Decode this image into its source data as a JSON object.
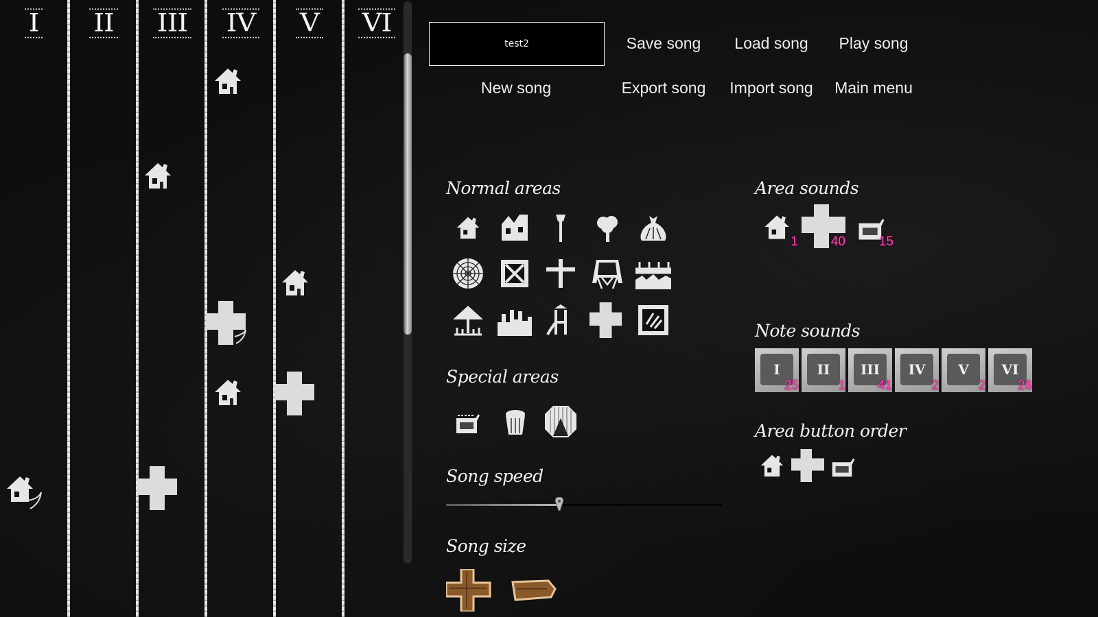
{
  "grid": {
    "columns": [
      {
        "label": "I"
      },
      {
        "label": "II"
      },
      {
        "label": "III"
      },
      {
        "label": "IV"
      },
      {
        "label": "V"
      },
      {
        "label": "VI"
      }
    ],
    "placed_areas": [
      {
        "column": "IV",
        "row": 1,
        "area": "house"
      },
      {
        "column": "III",
        "row": 3,
        "area": "house"
      },
      {
        "column": "V",
        "row": 5,
        "area": "house"
      },
      {
        "column": "IV",
        "row": 6,
        "area": "cross",
        "flag": "note-tail"
      },
      {
        "column": "IV",
        "row": 7,
        "area": "house"
      },
      {
        "column": "V",
        "row": 7,
        "area": "cross"
      },
      {
        "column": "I",
        "row": 9,
        "area": "house",
        "flag": "note-tail"
      },
      {
        "column": "III",
        "row": 9,
        "area": "cross"
      }
    ]
  },
  "song_name": "test2",
  "menu": {
    "save": "Save song",
    "load": "Load song",
    "play": "Play song",
    "new": "New song",
    "export": "Export song",
    "import": "Import song",
    "main_menu": "Main menu"
  },
  "sections": {
    "normal_areas": "Normal areas",
    "special_areas": "Special areas",
    "song_speed": "Song speed",
    "song_size": "Song size",
    "area_sounds": "Area sounds",
    "note_sounds": "Note sounds",
    "area_button_order": "Area button order"
  },
  "normal_areas": [
    "house-icon",
    "factory-icon",
    "tower-icon",
    "tree-icon",
    "sack-icon",
    "web-icon",
    "crate-icon",
    "cross-grave-icon",
    "skirt-icon",
    "fence-icon",
    "umbrella-icon",
    "city-icon",
    "playground-icon",
    "plus-block-icon",
    "window-icon"
  ],
  "special_areas": [
    "cart-icon",
    "basket-icon",
    "tent-icon"
  ],
  "song_speed": {
    "value_fraction": 0.41
  },
  "song_size": {
    "increase": "plus-plank-icon",
    "decrease": "minus-plank-icon"
  },
  "area_sounds": [
    {
      "icon": "house-icon",
      "count": "1"
    },
    {
      "icon": "plus-block-icon",
      "count": "40"
    },
    {
      "icon": "cart-icon",
      "count": "15"
    }
  ],
  "note_sounds": [
    {
      "label": "I",
      "count": "25"
    },
    {
      "label": "II",
      "count": "1"
    },
    {
      "label": "III",
      "count": "41"
    },
    {
      "label": "IV",
      "count": "2"
    },
    {
      "label": "V",
      "count": "2"
    },
    {
      "label": "VI",
      "count": "26"
    }
  ],
  "area_button_order": [
    "house-icon",
    "plus-block-icon",
    "cart-icon"
  ],
  "colors": {
    "badge": "#ff3ec8",
    "text": "#eeeeee",
    "background": "#0d0d0d"
  }
}
